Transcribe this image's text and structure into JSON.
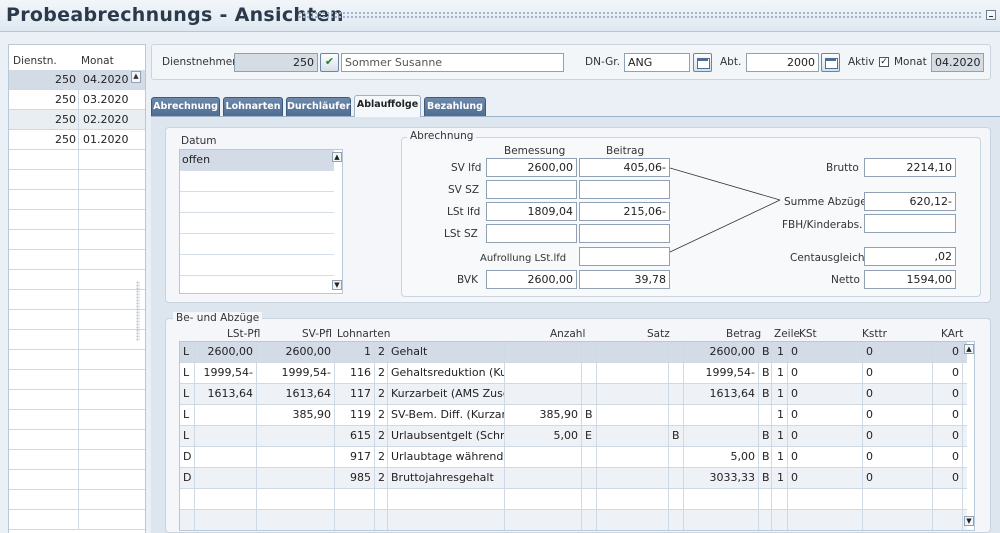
{
  "window": {
    "title": "Probeabrechnungs - Ansichten"
  },
  "left_list": {
    "col_dienstn": "Dienstn.",
    "col_monat": "Monat",
    "rows": [
      {
        "dienstn": "250",
        "monat": "04.2020"
      },
      {
        "dienstn": "250",
        "monat": "03.2020"
      },
      {
        "dienstn": "250",
        "monat": "02.2020"
      },
      {
        "dienstn": "250",
        "monat": "01.2020"
      }
    ]
  },
  "header": {
    "dienstnehmer_label": "Dienstnehmer",
    "dienstnehmer_nr": "250",
    "dienstnehmer_name": "Sommer Susanne",
    "dngr_label": "DN-Gr.",
    "dngr_value": "ANG",
    "abt_label": "Abt.",
    "abt_value": "2000",
    "aktiv_label": "Aktiv",
    "aktiv_checked": true,
    "monat_label": "Monat",
    "monat_value": "04.2020"
  },
  "tabs": [
    "Abrechnung",
    "Lohnarten",
    "Durchläufer",
    "Ablauffolge",
    "Bezahlung"
  ],
  "active_tab": "Ablauffolge",
  "datum": {
    "label": "Datum",
    "rows": [
      "offen"
    ]
  },
  "abrechnung": {
    "group_title": "Abrechnung",
    "col_bemessung": "Bemessung",
    "col_beitrag": "Beitrag",
    "sv_lfd": {
      "label": "SV lfd",
      "bemessung": "2600,00",
      "beitrag": "405,06-"
    },
    "sv_sz": {
      "label": "SV SZ",
      "bemessung": "",
      "beitrag": ""
    },
    "lst_lfd": {
      "label": "LSt lfd",
      "bemessung": "1809,04",
      "beitrag": "215,06-"
    },
    "lst_sz": {
      "label": "LSt SZ",
      "bemessung": "",
      "beitrag": ""
    },
    "aufrollung": {
      "label": "Aufrollung LSt.lfd",
      "beitrag": ""
    },
    "bvk": {
      "label": "BVK",
      "bemessung": "2600,00",
      "beitrag": "39,78"
    },
    "brutto": {
      "label": "Brutto",
      "value": "2214,10"
    },
    "summe_abzuege": {
      "label": "Summe Abzüge",
      "value": "620,12-"
    },
    "fbh": {
      "label": "FBH/Kinderabs.",
      "value": ""
    },
    "centausgleich": {
      "label": "Centausgleich",
      "value": ",02"
    },
    "netto": {
      "label": "Netto",
      "value": "1594,00"
    }
  },
  "be_abzuege": {
    "group_title": "Be- und Abzüge",
    "headers": {
      "lst_pfl": "LSt-Pfl",
      "sv_pfl": "SV-Pfl",
      "lohnarten": "Lohnarten",
      "anzahl": "Anzahl",
      "satz": "Satz",
      "betrag": "Betrag",
      "zeile": "Zeile",
      "kst": "KSt",
      "ksttr": "Ksttr",
      "kart": "KArt"
    },
    "rows": [
      {
        "typ": "L",
        "lst_pfl": "2600,00",
        "sv_pfl": "2600,00",
        "la_nr": "1",
        "la_k": "2",
        "la_text": "Gehalt",
        "anzahl": "",
        "anzahl_e": "",
        "satz": "",
        "satz_e": "",
        "betrag": "2600,00",
        "betrag_e": "B",
        "zeile": "1",
        "kst": "0",
        "ksttr": "0",
        "kart": "0"
      },
      {
        "typ": "L",
        "lst_pfl": "1999,54-",
        "sv_pfl": "1999,54-",
        "la_nr": "116",
        "la_k": "2",
        "la_text": "Gehaltsreduktion (Kurz",
        "anzahl": "",
        "anzahl_e": "",
        "satz": "",
        "satz_e": "",
        "betrag": "1999,54-",
        "betrag_e": "B",
        "zeile": "1",
        "kst": "0",
        "ksttr": "0",
        "kart": "0"
      },
      {
        "typ": "L",
        "lst_pfl": "1613,64",
        "sv_pfl": "1613,64",
        "la_nr": "117",
        "la_k": "2",
        "la_text": "Kurzarbeit (AMS Zusch",
        "anzahl": "",
        "anzahl_e": "",
        "satz": "",
        "satz_e": "",
        "betrag": "1613,64",
        "betrag_e": "B",
        "zeile": "1",
        "kst": "0",
        "ksttr": "0",
        "kart": "0"
      },
      {
        "typ": "L",
        "lst_pfl": "",
        "sv_pfl": "385,90",
        "la_nr": "119",
        "la_k": "2",
        "la_text": "SV-Bem. Diff. (Kurzarbe",
        "anzahl": "385,90",
        "anzahl_e": "B",
        "satz": "",
        "satz_e": "",
        "betrag": "",
        "betrag_e": "",
        "zeile": "1",
        "kst": "0",
        "ksttr": "0",
        "kart": "0"
      },
      {
        "typ": "L",
        "lst_pfl": "",
        "sv_pfl": "",
        "la_nr": "615",
        "la_k": "2",
        "la_text": "Urlaubsentgelt (Schnitt",
        "anzahl": "5,00",
        "anzahl_e": "E",
        "satz": "",
        "satz_e": "B",
        "betrag": "",
        "betrag_e": "B",
        "zeile": "1",
        "kst": "0",
        "ksttr": "0",
        "kart": "0"
      },
      {
        "typ": "D",
        "lst_pfl": "",
        "sv_pfl": "",
        "la_nr": "917",
        "la_k": "2",
        "la_text": "Urlaubtage während KA",
        "anzahl": "",
        "anzahl_e": "",
        "satz": "",
        "satz_e": "",
        "betrag": "5,00",
        "betrag_e": "B",
        "zeile": "1",
        "kst": "0",
        "ksttr": "0",
        "kart": "0"
      },
      {
        "typ": "D",
        "lst_pfl": "",
        "sv_pfl": "",
        "la_nr": "985",
        "la_k": "2",
        "la_text": "Bruttojahresgehalt",
        "anzahl": "",
        "anzahl_e": "",
        "satz": "",
        "satz_e": "",
        "betrag": "3033,33",
        "betrag_e": "B",
        "zeile": "1",
        "kst": "0",
        "ksttr": "0",
        "kart": "0"
      }
    ]
  }
}
